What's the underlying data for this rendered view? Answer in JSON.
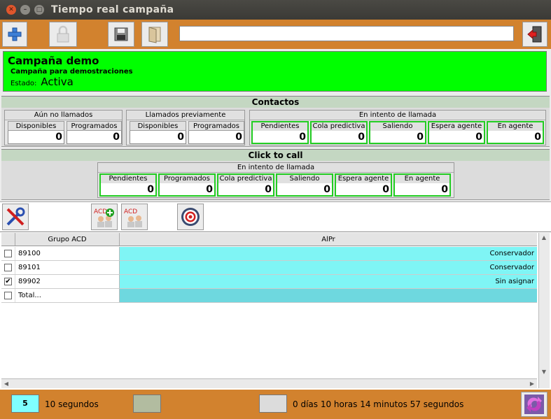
{
  "window": {
    "title": "Tiempo real campaña"
  },
  "campaign": {
    "name": "Campaña demo",
    "description": "Campaña para demostraciones",
    "state_label": "Estado:",
    "state_value": "Activa"
  },
  "contactos": {
    "title": "Contactos",
    "groups": [
      {
        "title": "Aún no llamados",
        "cells": [
          {
            "label": "Disponibles",
            "value": "0"
          },
          {
            "label": "Programados",
            "value": "0"
          }
        ]
      },
      {
        "title": "Llamados previamente",
        "cells": [
          {
            "label": "Disponibles",
            "value": "0"
          },
          {
            "label": "Programados",
            "value": "0"
          }
        ]
      },
      {
        "title": "En intento de llamada",
        "cells": [
          {
            "label": "Pendientes",
            "value": "0"
          },
          {
            "label": "Cola predictiva",
            "value": "0"
          },
          {
            "label": "Saliendo",
            "value": "0"
          },
          {
            "label": "Espera agente",
            "value": "0"
          },
          {
            "label": "En agente",
            "value": "0"
          }
        ]
      }
    ]
  },
  "click_to_call": {
    "title": "Click to call",
    "group_title": "En intento de llamada",
    "cells": [
      {
        "label": "Pendientes",
        "value": "0"
      },
      {
        "label": "Programados",
        "value": "0"
      },
      {
        "label": "Cola predictiva",
        "value": "0"
      },
      {
        "label": "Saliendo",
        "value": "0"
      },
      {
        "label": "Espera agente",
        "value": "0"
      },
      {
        "label": "En agente",
        "value": "0"
      }
    ]
  },
  "actions": {
    "acd_label_1": "ACD",
    "acd_label_2": "ACD"
  },
  "table": {
    "columns": [
      "Grupo ACD",
      "AlPr"
    ],
    "rows": [
      {
        "checked": false,
        "group": "89100",
        "alpr": "Conservador",
        "mark": ""
      },
      {
        "checked": false,
        "group": "89101",
        "alpr": "Conservador",
        "mark": ""
      },
      {
        "checked": true,
        "group": "89902",
        "alpr": "Sin asignar",
        "mark": "✔"
      },
      {
        "checked": false,
        "group": "Total...",
        "alpr": "",
        "mark": ""
      }
    ]
  },
  "status": {
    "refresh_value": "5",
    "refresh_label": "10 segundos",
    "elapsed": "0 días 10 horas 14 minutos 57 segundos"
  },
  "colors": {
    "toolbar": "#d2822e",
    "active": "#00ff00",
    "cyan": "#7ff5f5"
  },
  "icons": [
    "close-icon",
    "minimize-icon",
    "maximize-icon",
    "add-icon",
    "lock-icon",
    "save-icon",
    "door-icon",
    "exit-icon",
    "tools-icon",
    "acd-add-icon",
    "acd-icon",
    "target-icon",
    "refresh-icon"
  ]
}
